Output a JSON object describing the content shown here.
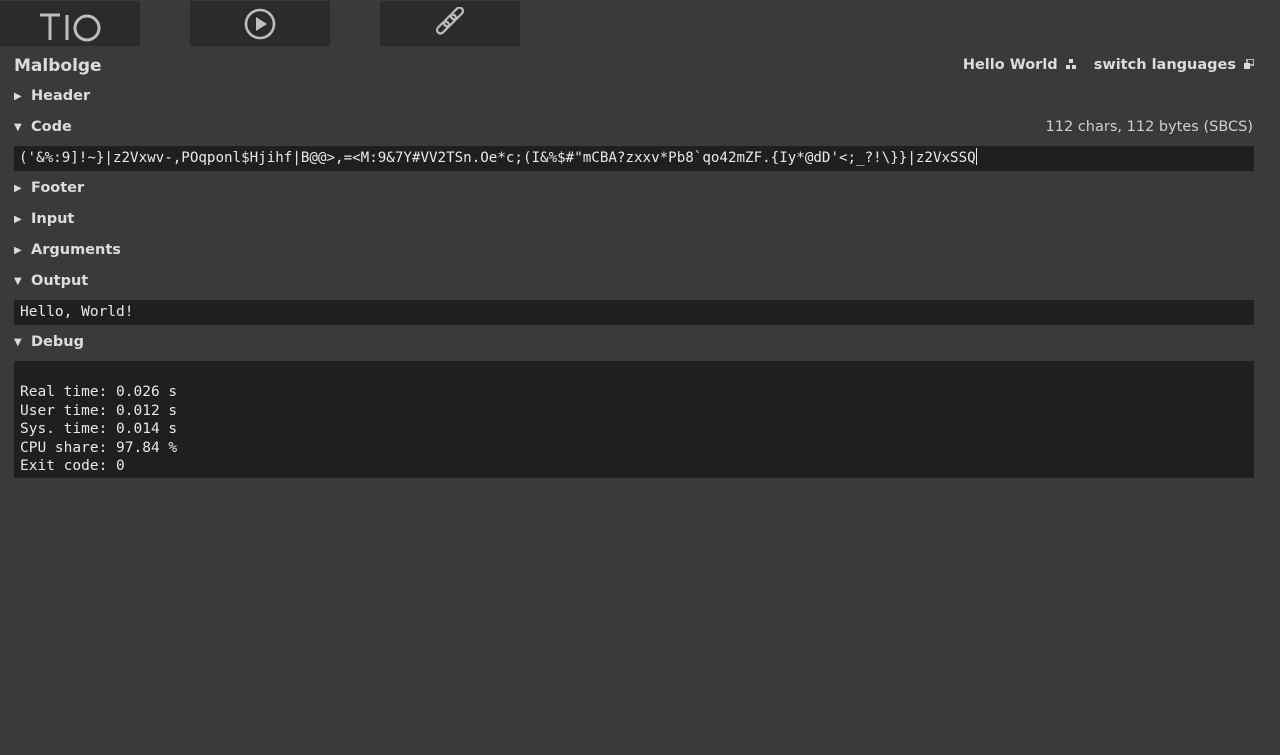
{
  "toolbar": {
    "logo_text": "TIO",
    "run_label": "Run",
    "permalink_label": "Permalink"
  },
  "language": "Malbolge",
  "top_links": {
    "hello_world": "Hello World",
    "switch_languages": "switch languages"
  },
  "sections": {
    "header": "Header",
    "code": "Code",
    "footer": "Footer",
    "input": "Input",
    "arguments": "Arguments",
    "output": "Output",
    "debug": "Debug"
  },
  "code": {
    "count": "112 chars, 112 bytes (SBCS)",
    "value": "('&%:9]!~}|z2Vxwv-,POqponl$Hjihf|B@@>,=<M:9&7Y#VV2TSn.Oe*c;(I&%$#\"mCBA?zxxv*Pb8`qo42mZF.{Iy*@dD'<;_?!\\}}|z2VxSSQ"
  },
  "output": {
    "value": "Hello, World!"
  },
  "debug": {
    "lines": [
      "Real time: 0.026 s",
      "User time: 0.012 s",
      "Sys. time: 0.014 s",
      "CPU share: 97.84 %",
      "Exit code: 0"
    ]
  }
}
